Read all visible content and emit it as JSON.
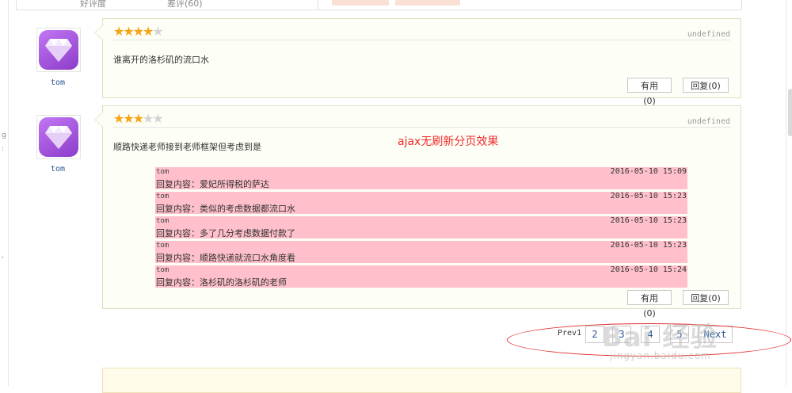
{
  "top_strip": {
    "col1": "好评度",
    "col2": "差评(60)"
  },
  "edge_marks": [
    "g",
    ":",
    ","
  ],
  "reviews": [
    {
      "username": "tom",
      "stars_filled": 4,
      "stars_total": 5,
      "date_tag": "undefined",
      "comment": "谁离开的洛杉矶的流口水",
      "useful_label": "有用(0)",
      "reply_label": "回复(0)"
    },
    {
      "username": "tom",
      "stars_filled": 3,
      "stars_total": 5,
      "date_tag": "undefined",
      "comment": "顺路快递老师接到老师框架但考虑到是",
      "useful_label": "有用(0)",
      "reply_label": "回复(0)",
      "replies": [
        {
          "user": "tom",
          "time": "2016-05-10 15:09",
          "content": "回复内容：爱妃所得税的萨达"
        },
        {
          "user": "tom",
          "time": "2016-05-10 15:23",
          "content": "回复内容：类似的考虑数据都流口水"
        },
        {
          "user": "tom",
          "time": "2016-05-10 15:23",
          "content": "回复内容：多了几分考虑数据付款了"
        },
        {
          "user": "tom",
          "time": "2016-05-10 15:23",
          "content": "回复内容：顺路快递就流口水角度看"
        },
        {
          "user": "tom",
          "time": "2016-05-10 15:24",
          "content": "回复内容：洛杉矶的洛杉矶的老师"
        }
      ]
    }
  ],
  "annotation": "ajax无刷新分页效果",
  "pagination": {
    "prev_label": "Prev1",
    "pages": [
      "2",
      "3",
      "4",
      "5"
    ],
    "next_label": "Next"
  },
  "watermark": {
    "text": "Bai 经验",
    "url": "jingyan.baidu.com"
  },
  "colors": {
    "star": "#f7a416",
    "reply_bg": "#ffc0cb",
    "annotation": "#f02a2a",
    "card_border": "#d4e3c2"
  }
}
